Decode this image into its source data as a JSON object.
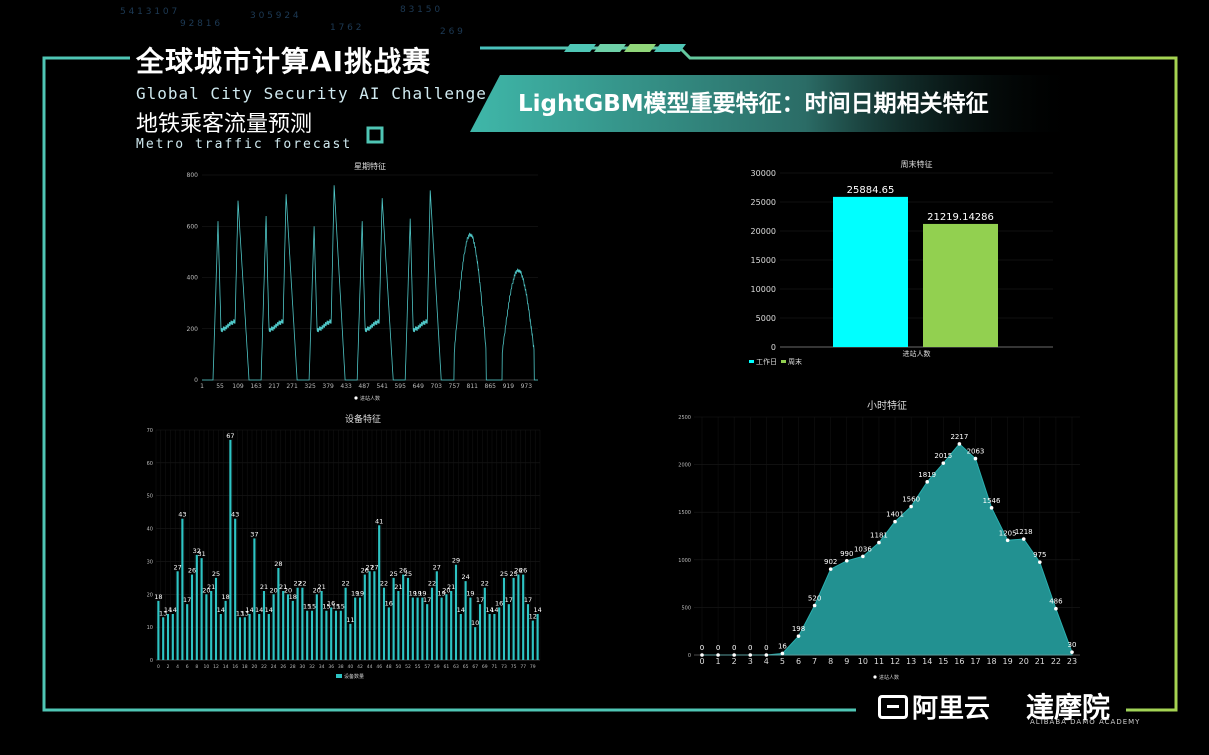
{
  "header": {
    "brand_zh": "全球城市计算AI挑战赛",
    "brand_en": "Global City Security AI Challenge",
    "brand_sub": "地铁乘客流量预测",
    "brand_sub_en": "Metro traffic forecast",
    "title": "LightGBM模型重要特征：时间日期相关特征"
  },
  "footer": {
    "logo_ali": "阿里云",
    "logo_damo": "達摩院",
    "logo_damo_en": "ALIBABA DAMO ACADEMY"
  },
  "colors": {
    "frame_left": "#4fc6b5",
    "frame_right": "#9bd05a",
    "teal": "#2ec4c4",
    "cyan": "#00ffff",
    "green": "#92d050"
  },
  "chart_data": [
    {
      "id": "week",
      "type": "line",
      "title": "星期特征",
      "legend": [
        "进站人数"
      ],
      "ylim": [
        0,
        800
      ],
      "yticks": [
        0,
        200,
        400,
        600,
        800
      ],
      "xticks": [
        "1",
        "55",
        "109",
        "163",
        "217",
        "271",
        "325",
        "379",
        "433",
        "487",
        "541",
        "595",
        "649",
        "703",
        "757",
        "811",
        "865",
        "919",
        "973"
      ],
      "x_count": 1008,
      "day_peaks": [
        {
          "morning": 620,
          "evening": 700
        },
        {
          "morning": 640,
          "evening": 725
        },
        {
          "morning": 600,
          "evening": 760
        },
        {
          "morning": 620,
          "evening": 710
        },
        {
          "morning": 630,
          "evening": 740
        },
        {
          "morning": 450,
          "evening": 560
        },
        {
          "morning": 400,
          "evening": 420
        }
      ]
    },
    {
      "id": "weekend",
      "type": "bar",
      "title": "周末特征",
      "categories": [
        "进站人数"
      ],
      "series": [
        {
          "name": "工作日",
          "values": [
            25884.65
          ],
          "color": "#00ffff"
        },
        {
          "name": "周末",
          "values": [
            21219.14286
          ],
          "color": "#92d050"
        }
      ],
      "data_labels": [
        "25884.65",
        "21219.14286"
      ],
      "ylim": [
        0,
        30000
      ],
      "yticks": [
        0,
        5000,
        10000,
        15000,
        20000,
        25000,
        30000
      ],
      "legend": [
        "工作日",
        "周末"
      ]
    },
    {
      "id": "device",
      "type": "bar",
      "title": "设备特征",
      "legend": [
        "设备数量"
      ],
      "ylim": [
        0,
        70
      ],
      "yticks": [
        0,
        10,
        20,
        30,
        40,
        50,
        60,
        70
      ],
      "xticks": [
        "0",
        "2",
        "4",
        "6",
        "8",
        "10",
        "12",
        "14",
        "16",
        "18",
        "20",
        "22",
        "24",
        "26",
        "28",
        "30",
        "32",
        "34",
        "36",
        "38",
        "40",
        "42",
        "44",
        "46",
        "48",
        "50",
        "52",
        "55",
        "57",
        "59",
        "61",
        "63",
        "65",
        "67",
        "69",
        "71",
        "73",
        "75",
        "77",
        "79"
      ],
      "values": [
        18,
        13,
        14,
        14,
        27,
        43,
        17,
        26,
        32,
        31,
        20,
        21,
        25,
        14,
        18,
        67,
        43,
        13,
        13,
        14,
        37,
        14,
        21,
        14,
        20,
        28,
        21,
        20,
        18,
        22,
        22,
        15,
        15,
        20,
        21,
        15,
        16,
        15,
        15,
        22,
        11,
        19,
        19,
        26,
        27,
        27,
        41,
        22,
        16,
        25,
        21,
        26,
        25,
        19,
        19,
        19,
        17,
        22,
        27,
        19,
        20,
        21,
        29,
        14,
        24,
        19,
        10,
        17,
        22,
        14,
        14,
        16,
        25,
        17,
        25,
        26,
        26,
        17,
        12,
        14
      ]
    },
    {
      "id": "hour",
      "type": "area",
      "title": "小时特征",
      "legend": [
        "进站人数"
      ],
      "ylim": [
        0,
        2500
      ],
      "yticks": [
        0,
        500,
        1000,
        1500,
        2000,
        2500
      ],
      "categories": [
        "0",
        "1",
        "2",
        "3",
        "4",
        "5",
        "6",
        "7",
        "8",
        "9",
        "10",
        "11",
        "12",
        "13",
        "14",
        "15",
        "16",
        "17",
        "18",
        "19",
        "20",
        "21",
        "22",
        "23"
      ],
      "values": [
        0,
        0,
        0,
        0,
        0,
        16,
        198,
        520,
        902,
        990,
        1036,
        1181,
        1401,
        1560,
        1819,
        2015,
        2217,
        2063,
        1546,
        1205,
        1218,
        975,
        486,
        30
      ]
    }
  ]
}
